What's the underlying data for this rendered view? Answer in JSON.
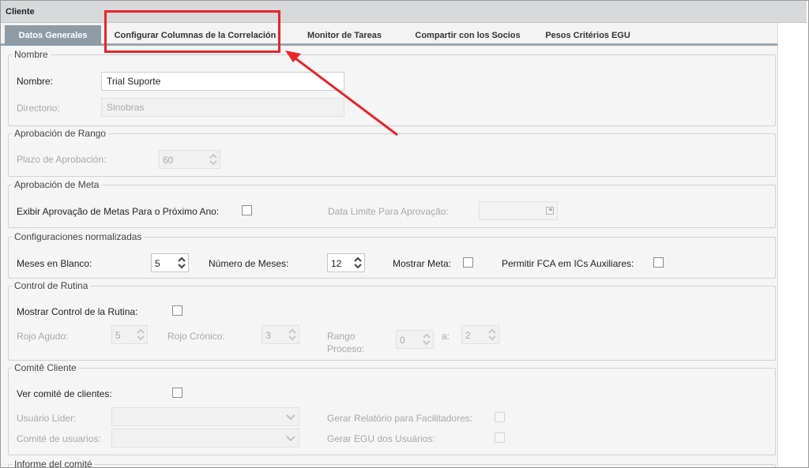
{
  "window": {
    "title": "Cliente"
  },
  "tabs": [
    {
      "label": "Datos Generales",
      "active": true
    },
    {
      "label": "Configurar Columnas de la Correlación",
      "active": false
    },
    {
      "label": "Monitor de Tareas",
      "active": false
    },
    {
      "label": "Compartir con los Socios",
      "active": false
    },
    {
      "label": "Pesos Critérios EGU",
      "active": false
    }
  ],
  "nombre_group": {
    "legend": "Nombre",
    "nombre_label": "Nombre:",
    "nombre_value": "Trial Suporte",
    "directorio_label": "Directorio:",
    "directorio_value": "Sinobras"
  },
  "aprobacion_rango": {
    "legend": "Aprobación de Rango",
    "plazo_label": "Plazo de Aprobación:",
    "plazo_value": "60"
  },
  "aprobacion_meta": {
    "legend": "Aprobación de Meta",
    "exibir_label": "Exibir Aprovação de Metas Para o Próximo Ano:",
    "exibir_checked": false,
    "data_limite_label": "Data Limite Para Aprovação:",
    "data_limite_value": ""
  },
  "config_normalizadas": {
    "legend": "Configuraciones normalizadas",
    "meses_blanco_label": "Meses en Blanco:",
    "meses_blanco_value": "5",
    "numero_meses_label": "Número de Meses:",
    "numero_meses_value": "12",
    "mostrar_meta_label": "Mostrar Meta:",
    "mostrar_meta_checked": false,
    "permitir_fca_label": "Permitir FCA em ICs Auxiliares:",
    "permitir_fca_checked": false
  },
  "control_rutina": {
    "legend": "Control de Rutina",
    "mostrar_label": "Mostrar Control de la Rutina:",
    "mostrar_checked": false,
    "rojo_agudo_label": "Rojo Agudo:",
    "rojo_agudo_value": "5",
    "rojo_cronico_label": "Rojo Crónico:",
    "rojo_cronico_value": "3",
    "rango_label_1": "Rango",
    "rango_label_2": "Proceso:",
    "rango_from": "0",
    "a_label": "a:",
    "rango_to": "2"
  },
  "comite_cliente": {
    "legend": "Comitê Cliente",
    "ver_label": "Ver comité de clientes:",
    "ver_checked": false,
    "usuario_lider_label": "Usuário Líder:",
    "usuario_lider_value": "",
    "comite_usuarios_label": "Comité de usuarios:",
    "comite_usuarios_value": "",
    "gerar_relatorio_label": "Gerar Relatório para Facilitadores:",
    "gerar_egu_label": "Gerar EGU dos Usuários:"
  },
  "informe_comite": {
    "legend": "Informe del comité"
  },
  "annotation": {
    "color": "#e8262a"
  }
}
